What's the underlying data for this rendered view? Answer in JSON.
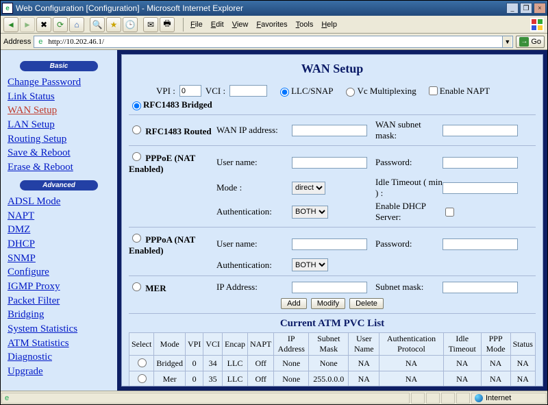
{
  "window": {
    "title": "Web Configuration [Configuration] - Microsoft Internet Explorer",
    "min": "_",
    "max": "❐",
    "close": "×"
  },
  "menubar": {
    "file": "File",
    "edit": "Edit",
    "view": "View",
    "fav": "Favorites",
    "tools": "Tools",
    "help": "Help"
  },
  "addr": {
    "label": "Address",
    "url": "http://10.202.46.1/",
    "go": "Go"
  },
  "nav": {
    "basic_label": "Basic",
    "advanced_label": "Advanced",
    "basic": [
      "Change Password",
      "Link Status",
      "WAN Setup",
      "LAN Setup",
      "Routing Setup",
      "Save & Reboot",
      "Erase & Reboot"
    ],
    "active_index": 2,
    "advanced": [
      "ADSL Mode",
      "NAPT",
      "DMZ",
      "DHCP",
      "SNMP",
      "Configure",
      "IGMP Proxy",
      "Packet Filter",
      "Bridging",
      "System Statistics",
      "ATM Statistics",
      "Diagnostic",
      "Upgrade"
    ]
  },
  "wan": {
    "heading": "WAN Setup",
    "vpi_label": "VPI :",
    "vpi_value": "0",
    "vci_label": "VCI :",
    "vci_value": "",
    "llc": "LLC/SNAP",
    "vcmux": "Vc Multiplexing",
    "enable_napt": "Enable NAPT",
    "opt_bridged": "RFC1483 Bridged",
    "opt_routed": "RFC1483 Routed",
    "wan_ip_label": "WAN IP address:",
    "wan_subnet_label": "WAN subnet mask:",
    "opt_pppoe": "PPPoE (NAT Enabled)",
    "user_label": "User name:",
    "pass_label": "Password:",
    "mode_label": "Mode :",
    "mode_value": "direct",
    "idle_label": "Idle Timeout ( min ) :",
    "auth_label": "Authentication:",
    "auth_value": "BOTH",
    "dhcp_label": "Enable DHCP Server:",
    "opt_pppoa": "PPPoA (NAT Enabled)",
    "opt_mer": "MER",
    "ip_addr_label": "IP Address:",
    "subnet_mask_label": "Subnet mask:",
    "btn_add": "Add",
    "btn_modify": "Modify",
    "btn_delete": "Delete",
    "atm_heading": "Current ATM PVC List",
    "headers": {
      "select": "Select",
      "mode": "Mode",
      "vpi": "VPI",
      "vci": "VCI",
      "encap": "Encap",
      "napt": "NAPT",
      "ip": "IP Address",
      "subnet": "Subnet Mask",
      "user": "User Name",
      "auth": "Authentication Protocol",
      "idle": "Idle Timeout",
      "ppp": "PPP Mode",
      "status": "Status"
    },
    "rows": [
      {
        "mode": "Bridged",
        "vpi": "0",
        "vci": "34",
        "encap": "LLC",
        "napt": "Off",
        "ip": "None",
        "subnet": "None",
        "user": "NA",
        "auth": "NA",
        "idle": "NA",
        "ppp": "NA",
        "status": "NA"
      },
      {
        "mode": "Mer",
        "vpi": "0",
        "vci": "35",
        "encap": "LLC",
        "napt": "Off",
        "ip": "None",
        "subnet": "255.0.0.0",
        "user": "NA",
        "auth": "NA",
        "idle": "NA",
        "ppp": "NA",
        "status": "NA"
      }
    ]
  },
  "status": {
    "zone": "Internet"
  }
}
